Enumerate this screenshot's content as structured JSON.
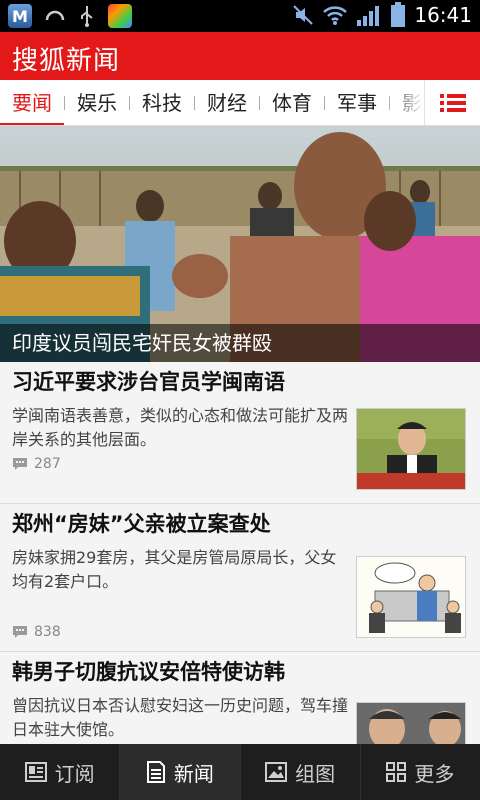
{
  "status_bar": {
    "time": "16:41",
    "left_icons": [
      "m-app-icon",
      "headset-icon",
      "usb-icon",
      "bag-app-icon"
    ],
    "right_icons": [
      "mute-icon",
      "wifi-icon",
      "signal-icon",
      "battery-icon"
    ]
  },
  "app": {
    "title": "搜狐新闻"
  },
  "tabs": [
    {
      "label": "要闻"
    },
    {
      "label": "娱乐"
    },
    {
      "label": "科技"
    },
    {
      "label": "财经"
    },
    {
      "label": "体育"
    },
    {
      "label": "军事"
    },
    {
      "label": "影视"
    }
  ],
  "hero": {
    "caption": "印度议员闯民宅奸民女被群殴"
  },
  "news": [
    {
      "title": "习近平要求涉台官员学闽南语",
      "summary": "学闽南语表善意，类似的心态和做法可能扩及两岸关系的其他层面。",
      "comments": "287"
    },
    {
      "title": "郑州“房妹”父亲被立案查处",
      "summary": "房妹家拥29套房，其父是房管局原局长，父女均有2套户口。",
      "comments": "838"
    },
    {
      "title": "韩男子切腹抗议安倍特使访韩",
      "summary": "曾因抗议日本否认慰安妇这一历史问题，驾车撞日本驻大使馆。",
      "comments": ""
    }
  ],
  "bottom_nav": [
    {
      "label": "订阅",
      "icon": "subscribe-icon"
    },
    {
      "label": "新闻",
      "icon": "news-icon"
    },
    {
      "label": "组图",
      "icon": "gallery-icon"
    },
    {
      "label": "更多",
      "icon": "more-grid-icon"
    }
  ],
  "colors": {
    "brand_red": "#e31919",
    "nav_bg": "#1e1e1e"
  }
}
